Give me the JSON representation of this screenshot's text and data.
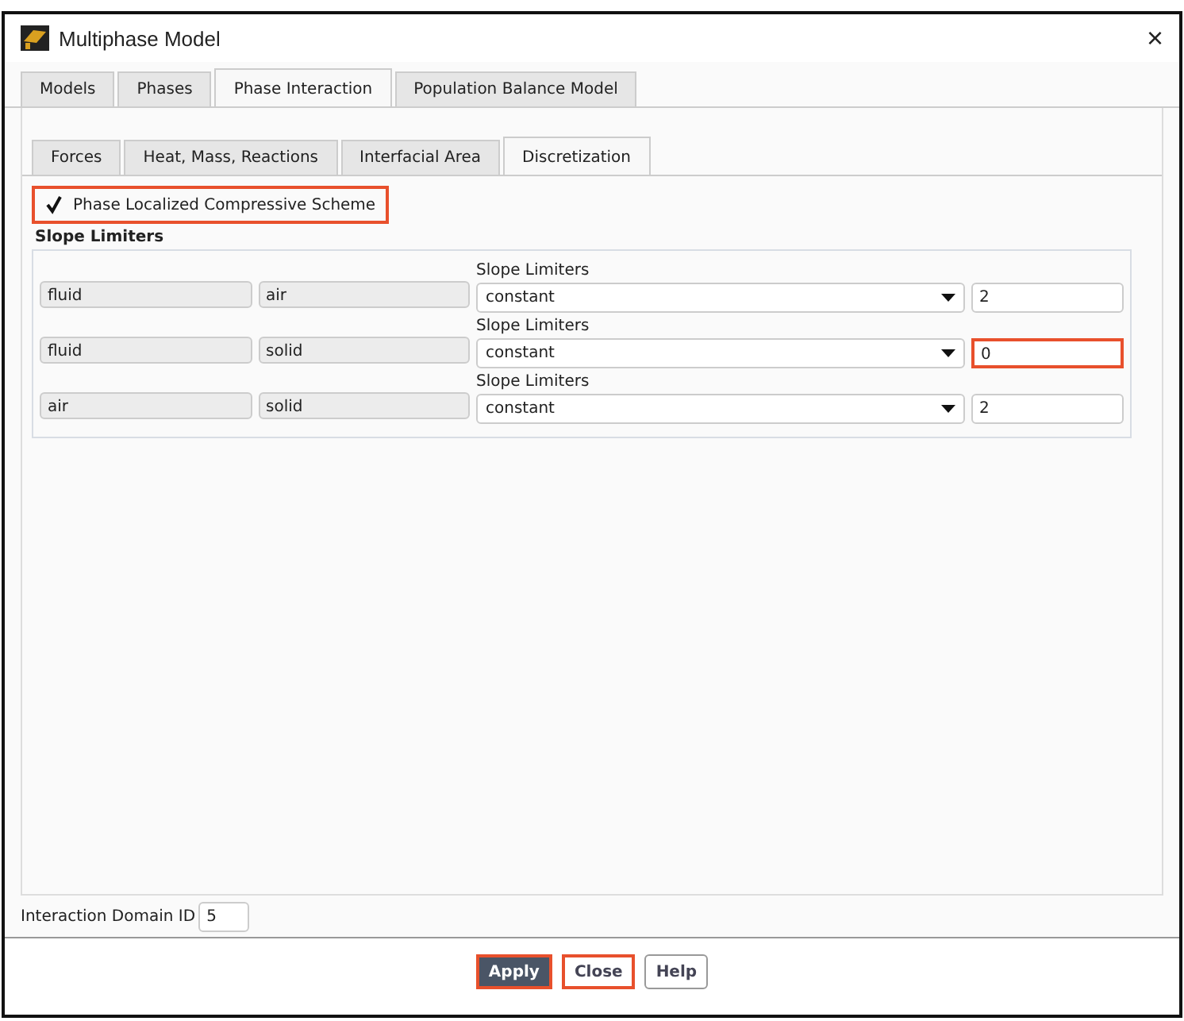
{
  "window": {
    "title": "Multiphase Model",
    "close": "×"
  },
  "tabs": [
    {
      "label": "Models",
      "selected": false
    },
    {
      "label": "Phases",
      "selected": false
    },
    {
      "label": "Phase Interaction",
      "selected": true
    },
    {
      "label": "Population Balance Model",
      "selected": false
    }
  ],
  "subtabs": [
    {
      "label": "Forces",
      "selected": false
    },
    {
      "label": "Heat, Mass, Reactions",
      "selected": false
    },
    {
      "label": "Interfacial Area",
      "selected": false
    },
    {
      "label": "Discretization",
      "selected": true
    }
  ],
  "scheme": {
    "label": "Phase Localized Compressive Scheme",
    "checked": true,
    "highlighted": true
  },
  "section_title": "Slope Limiters",
  "rows": [
    {
      "phase_1": "fluid",
      "phase_2": "air",
      "label": "Slope Limiters",
      "method": "constant",
      "value": "2",
      "highlighted": false
    },
    {
      "phase_1": "fluid",
      "phase_2": "solid",
      "label": "Slope Limiters",
      "method": "constant",
      "value": "0",
      "highlighted": true
    },
    {
      "phase_1": "air",
      "phase_2": "solid",
      "label": "Slope Limiters",
      "method": "constant",
      "value": "2",
      "highlighted": false
    }
  ],
  "domain_id": {
    "label": "Interaction Domain ID",
    "value": "5"
  },
  "buttons": [
    {
      "label": "Apply",
      "kind": "primary",
      "highlighted": true
    },
    {
      "label": "Close",
      "kind": "normal",
      "highlighted": true
    },
    {
      "label": "Help",
      "kind": "normal",
      "highlighted": false
    }
  ]
}
